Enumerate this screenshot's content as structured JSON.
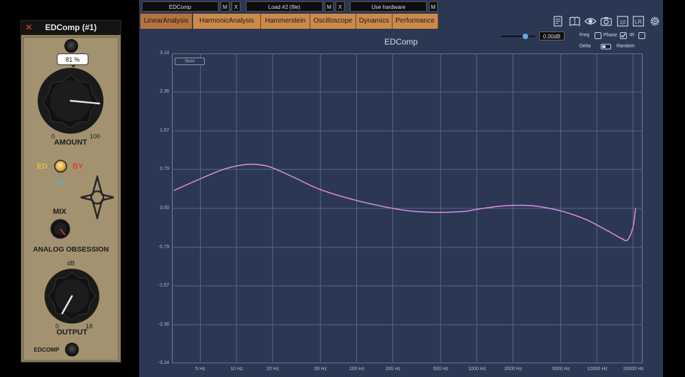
{
  "plugin": {
    "title": "EDComp (#1)",
    "close_icon": "close-icon",
    "amount": {
      "label": "AMOUNT",
      "value_badge": "81 %",
      "min": "0",
      "max": "100",
      "value_percent": 81
    },
    "mode": {
      "left": "ED",
      "right": "BY",
      "bottom": "CL"
    },
    "mix": {
      "label": "MIX"
    },
    "brand": "ANALOG OBSESSION",
    "output": {
      "label": "OUTPUT",
      "unit": "dB",
      "min": "0",
      "max": "18"
    },
    "name": "EDCOMP",
    "colors": {
      "ed": "#e7b94c",
      "by": "#d9442c",
      "cl": "#5aaed8"
    }
  },
  "analyzer": {
    "topbar": {
      "plugin_select": "EDComp",
      "m1": "M",
      "x1": "X",
      "load_select": "Load #2 (file)",
      "m2": "M",
      "x2": "X",
      "hardware_select": "Use hardware",
      "m3": "M"
    },
    "tabs": [
      "LinearAnalysis",
      "HarmonicAnalysis",
      "Hammerstein",
      "Oscilloscope",
      "Dynamics",
      "Performance"
    ],
    "active_tab": "LinearAnalysis",
    "gain_value": "0.00dB",
    "options": {
      "freq": "Freq",
      "phase": "Phase",
      "ir": "IR",
      "delta": "Delta",
      "random": "Random"
    },
    "store_button": "Store",
    "toolbar_icons": [
      "notes-icon",
      "book-icon",
      "eye-icon",
      "camera-icon",
      "half-icon",
      "lr-icon",
      "gear-icon"
    ],
    "half_label": "1|2",
    "lr_label": "LR"
  },
  "chart_data": {
    "type": "line",
    "title": "EDComp",
    "xscale": "log",
    "xlim": [
      2.9,
      24000
    ],
    "ylim": [
      -3.14,
      3.14
    ],
    "yticks": [
      3.14,
      2.36,
      1.57,
      0.79,
      0.0,
      -0.79,
      -1.57,
      -2.36,
      -3.14
    ],
    "ytick_labels": [
      "3.14",
      "2.36",
      "1.57",
      "0.79",
      "0.00",
      "-0.79",
      "-1.57",
      "-2.36",
      "-3.14"
    ],
    "xticks": [
      5,
      10,
      20,
      50,
      100,
      200,
      500,
      1000,
      2000,
      5000,
      10000,
      20000
    ],
    "xtick_labels": [
      "5 Hz",
      "10 Hz",
      "20 Hz",
      "50 Hz",
      "100 Hz",
      "200 Hz",
      "500 Hz",
      "1000 Hz",
      "2000 Hz",
      "5000 Hz",
      "10000 Hz",
      "20000 Hz"
    ],
    "grid": true,
    "series": [
      {
        "color": "#d98ae0",
        "x": [
          3,
          5,
          8,
          12,
          16,
          20,
          30,
          50,
          100,
          200,
          300,
          500,
          800,
          1000,
          1500,
          2000,
          3000,
          5000,
          8000,
          12000,
          16000,
          18000,
          20000,
          21000
        ],
        "y": [
          0.36,
          0.6,
          0.8,
          0.89,
          0.88,
          0.82,
          0.63,
          0.38,
          0.16,
          0.0,
          -0.06,
          -0.08,
          -0.06,
          -0.02,
          0.04,
          0.06,
          0.05,
          -0.05,
          -0.22,
          -0.44,
          -0.61,
          -0.64,
          -0.38,
          0.0
        ]
      }
    ]
  }
}
